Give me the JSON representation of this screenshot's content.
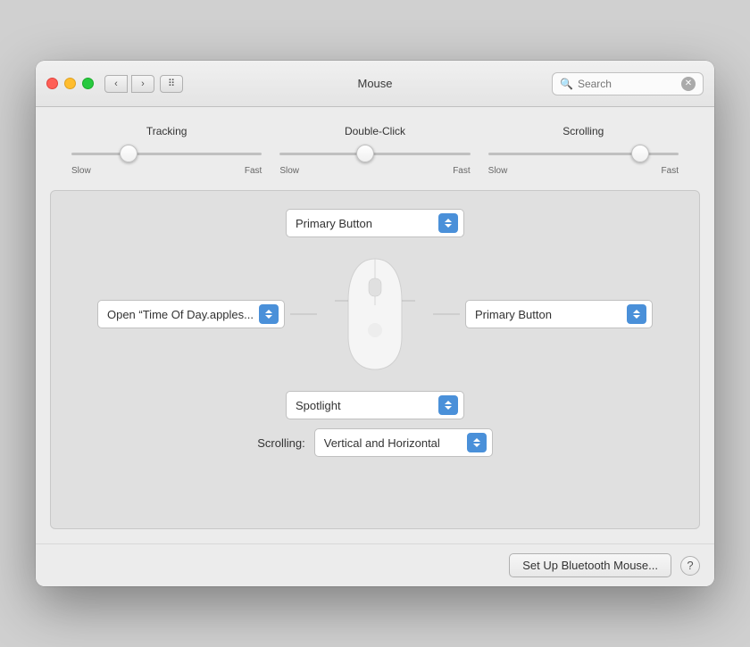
{
  "titlebar": {
    "title": "Mouse",
    "search_placeholder": "Search",
    "back_icon": "‹",
    "forward_icon": "›",
    "grid_icon": "⠿"
  },
  "sliders": [
    {
      "label": "Tracking",
      "slow_label": "Slow",
      "fast_label": "Fast",
      "value": 30
    },
    {
      "label": "Double-Click",
      "slow_label": "Slow",
      "fast_label": "Fast",
      "value": 45
    },
    {
      "label": "Scrolling",
      "slow_label": "Slow",
      "fast_label": "Fast",
      "value": 80
    }
  ],
  "dropdowns": {
    "top": "Primary Button",
    "left": "Open “Time Of Day.apples...",
    "right": "Primary Button",
    "bottom_center": "Spotlight",
    "scrolling_label": "Scrolling:",
    "scrolling": "Vertical and Horizontal"
  },
  "footer": {
    "setup_btn": "Set Up Bluetooth Mouse...",
    "help_btn": "?"
  }
}
